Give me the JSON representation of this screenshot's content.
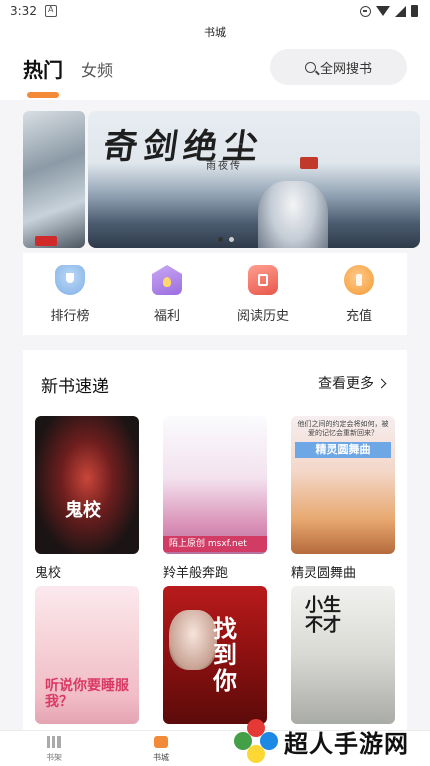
{
  "status_bar": {
    "time": "3:32"
  },
  "app_title": "书城",
  "header": {
    "tabs": [
      {
        "label": "热门",
        "active": true
      },
      {
        "label": "女频",
        "active": false
      }
    ],
    "search_label": "全网搜书",
    "accent_color": "#f28a37"
  },
  "banner": {
    "title": "奇剑绝尘",
    "subtitle": "雨夜传",
    "dots": 2,
    "active_dot": 0
  },
  "quick_menu": [
    {
      "label": "排行榜",
      "icon": "trophy-icon"
    },
    {
      "label": "福利",
      "icon": "gift-icon"
    },
    {
      "label": "阅读历史",
      "icon": "history-icon"
    },
    {
      "label": "充值",
      "icon": "recharge-icon"
    }
  ],
  "new_books": {
    "title": "新书速递",
    "more_label": "查看更多",
    "books": [
      {
        "title": "鬼校",
        "cover_text": "鬼校"
      },
      {
        "title": "羚羊般奔跑",
        "cover_text": "陌上原创 msxf.net"
      },
      {
        "title": "精灵圆舞曲",
        "cover_text": "精灵圆舞曲",
        "cover_top": "他们之间的约定会将如何，被爱的记忆会重新回来？"
      },
      {
        "title": "",
        "cover_text": "听说你要睡服我？"
      },
      {
        "title": "",
        "cover_text": "找到你"
      },
      {
        "title": "",
        "cover_text": "小生不才"
      }
    ]
  },
  "bottom_nav": [
    {
      "label": "书架",
      "active": false
    },
    {
      "label": "书城",
      "active": true
    }
  ],
  "watermark": {
    "text": "超人手游网"
  }
}
